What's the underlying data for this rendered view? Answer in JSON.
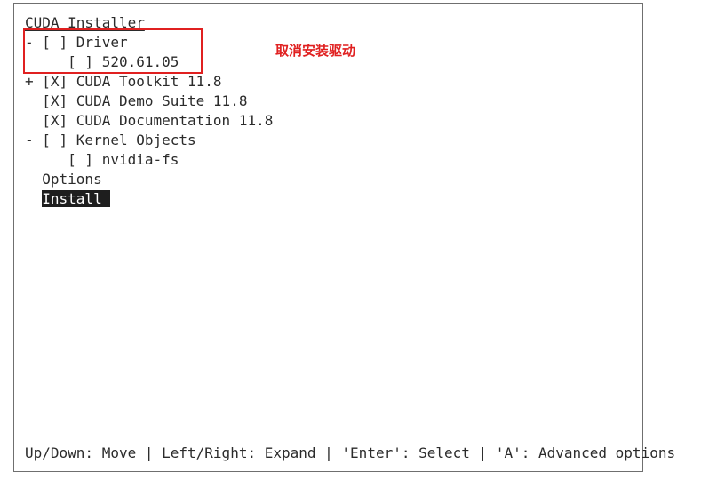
{
  "installer": {
    "title": "CUDA Installer",
    "items": [
      {
        "text": "- [ ] Driver"
      },
      {
        "text": "     [ ] 520.61.05"
      },
      {
        "text": "+ [X] CUDA Toolkit 11.8"
      },
      {
        "text": "  [X] CUDA Demo Suite 11.8"
      },
      {
        "text": "  [X] CUDA Documentation 11.8"
      },
      {
        "text": "- [ ] Kernel Objects"
      },
      {
        "text": "     [ ] nvidia-fs"
      },
      {
        "text": "  Options"
      }
    ],
    "install_indent": "  ",
    "install_label": "Install",
    "footer": "Up/Down: Move | Left/Right: Expand | 'Enter': Select | 'A': Advanced options"
  },
  "annotation": {
    "text": "取消安装驱动",
    "color": "#e02020"
  }
}
